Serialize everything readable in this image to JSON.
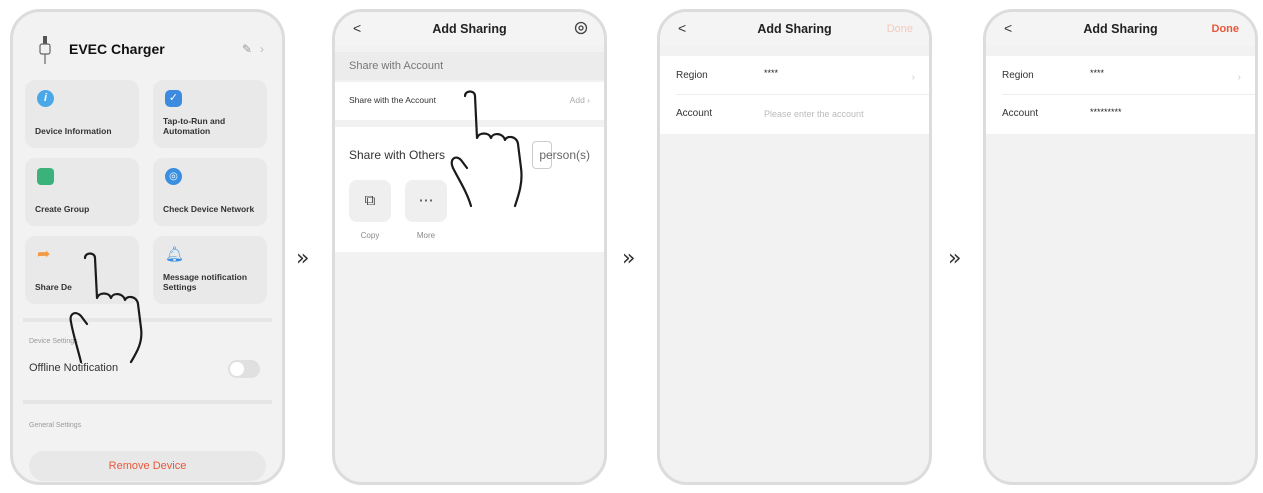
{
  "phone1": {
    "device_title": "EVEC Charger",
    "tiles": [
      {
        "label": "Device Information",
        "icon": "info-icon",
        "color": "#4aa8e8"
      },
      {
        "label": "Tap-to-Run and Automation",
        "icon": "automation-check-icon",
        "color": "#3c8be0"
      },
      {
        "label": "Create Group",
        "icon": "create-group-icon",
        "color": "#3ab27a"
      },
      {
        "label": "Check Device Network",
        "icon": "network-icon",
        "color": "#3a8fe0"
      },
      {
        "label": "Share De",
        "icon": "share-arrow-icon",
        "color": "#f29b45"
      },
      {
        "label": "Message notification Settings",
        "icon": "bell-icon",
        "color": "#3b8de0"
      }
    ],
    "device_settings_label": "Device Settings",
    "offline_notification": "Offline Notification",
    "general_settings_label": "General Settings",
    "remove_device": "Remove Device"
  },
  "phone2": {
    "back": "<",
    "title": "Add Sharing",
    "share_account_header": "Share with Account",
    "share_account_row": "Share with the Account",
    "add_label": "Add",
    "share_others": "Share with Others",
    "person_unit": "person(s)",
    "copy": "Copy",
    "more": "More"
  },
  "phone3": {
    "back": "<",
    "title": "Add Sharing",
    "done": "Done",
    "region_label": "Region",
    "region_value": "****",
    "account_label": "Account",
    "account_placeholder": "Please enter the account"
  },
  "phone4": {
    "back": "<",
    "title": "Add Sharing",
    "done": "Done",
    "region_label": "Region",
    "region_value": "****",
    "account_label": "Account",
    "account_value": "*********"
  },
  "arrows": [
    "»",
    "»",
    "»"
  ],
  "colors": {
    "done_active": "#e8573a",
    "done_inactive": "#f6c9bd",
    "remove": "#e8573a"
  }
}
